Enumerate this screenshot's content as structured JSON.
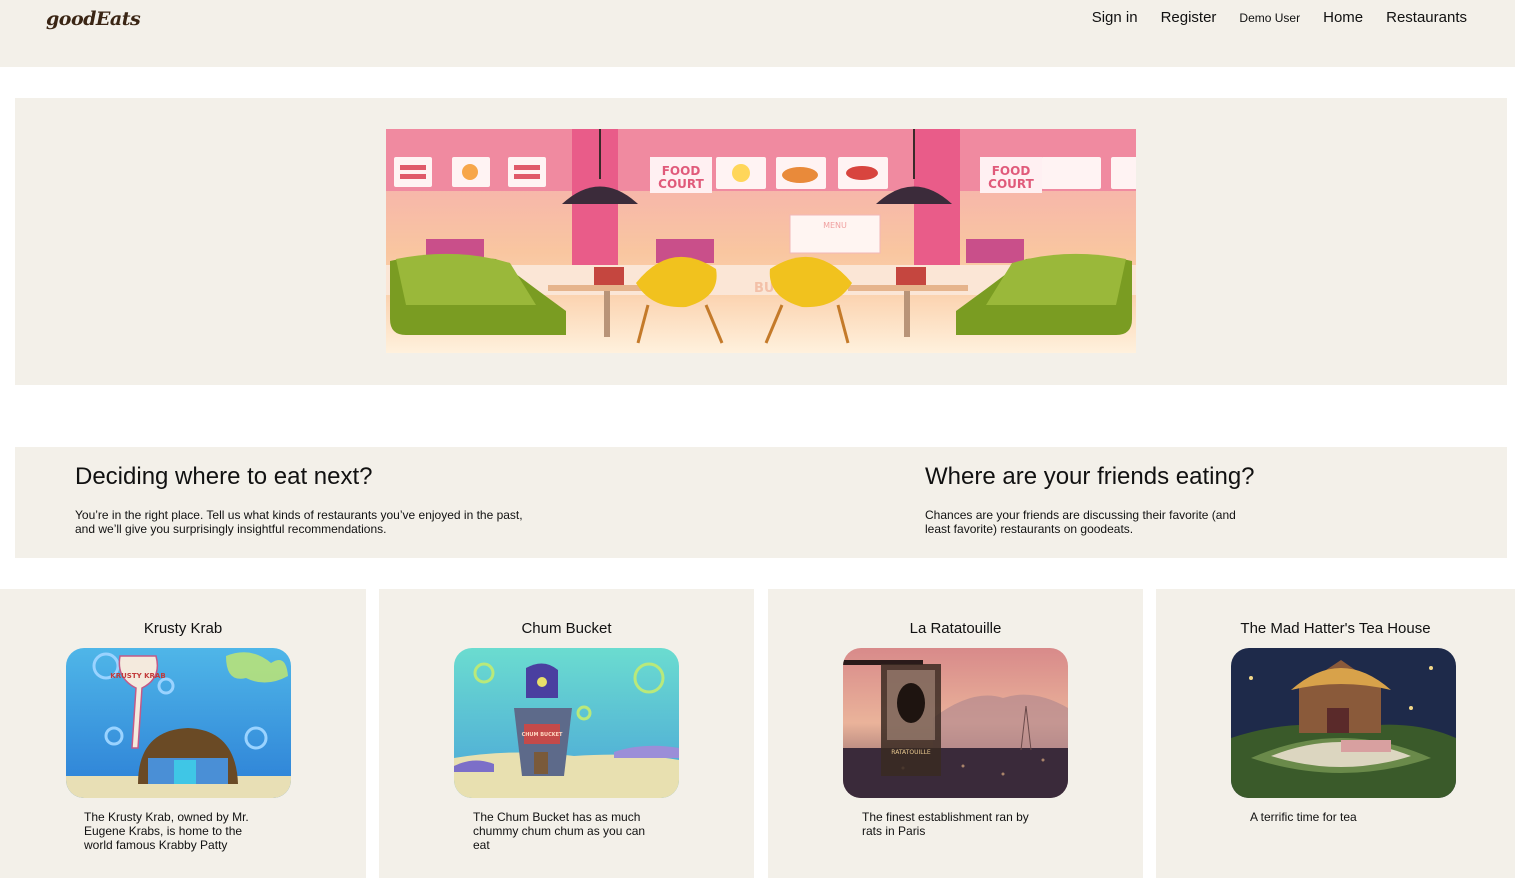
{
  "nav": {
    "logo": "goodEats",
    "links": [
      "Sign in",
      "Register",
      "Demo User",
      "Home",
      "Restaurants"
    ]
  },
  "hero": {
    "image_icon": "food-court-illustration",
    "sign_left": "FOOD\nCOURT",
    "sign_right": "FOOD\nCOURT",
    "menu": "MENU",
    "counter": "BURGE"
  },
  "info": {
    "left": {
      "title": "Deciding where to eat next?",
      "text": "You’re in the right place. Tell us what kinds of restaurants you’ve enjoyed in the past, and we’ll give you surprisingly insightful recommendations."
    },
    "right": {
      "title": "Where are your friends eating?",
      "text": "Chances are your friends are discussing their favorite (and least favorite) restaurants on goodeats."
    }
  },
  "restaurants": [
    {
      "name": "Krusty Krab",
      "description": "The Krusty Krab, owned by Mr. Eugene Krabs, is home to the world famous Krabby Patty",
      "image_icon": "krusty-krab-image",
      "sign": "KRUSTY KRAB"
    },
    {
      "name": "Chum Bucket",
      "description": "The Chum Bucket has as much chummy chum chum as you can eat",
      "image_icon": "chum-bucket-image",
      "sign": "CHUM BUCKET"
    },
    {
      "name": "La Ratatouille",
      "description": "The finest establishment ran by rats in Paris",
      "image_icon": "ratatouille-image",
      "sign": "RATATOUILLE"
    },
    {
      "name": "The Mad Hatter's Tea House",
      "description": "A terrific time for tea",
      "image_icon": "mad-hatter-image"
    }
  ],
  "colors": {
    "panel": "#f3f0e9",
    "logo": "#3a2514",
    "text": "#111111"
  }
}
